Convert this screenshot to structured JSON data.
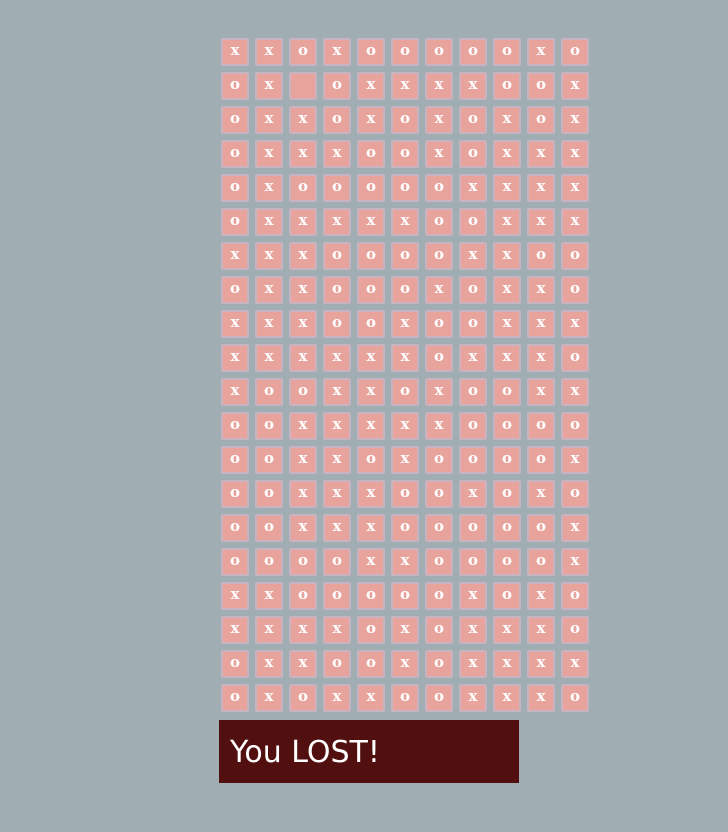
{
  "board": {
    "rows": [
      [
        "x",
        "x",
        "o",
        "x",
        "o",
        "o",
        "o",
        "o",
        "o",
        "x",
        "o"
      ],
      [
        "o",
        "x",
        "",
        "o",
        "x",
        "x",
        "x",
        "x",
        "o",
        "o",
        "x"
      ],
      [
        "o",
        "x",
        "x",
        "o",
        "x",
        "o",
        "x",
        "o",
        "x",
        "o",
        "x"
      ],
      [
        "o",
        "x",
        "x",
        "x",
        "o",
        "o",
        "x",
        "o",
        "x",
        "x",
        "x"
      ],
      [
        "o",
        "x",
        "o",
        "o",
        "o",
        "o",
        "o",
        "x",
        "x",
        "x",
        "x"
      ],
      [
        "o",
        "x",
        "x",
        "x",
        "x",
        "x",
        "o",
        "o",
        "x",
        "x",
        "x"
      ],
      [
        "x",
        "x",
        "x",
        "o",
        "o",
        "o",
        "o",
        "x",
        "x",
        "o",
        "o"
      ],
      [
        "o",
        "x",
        "x",
        "o",
        "o",
        "o",
        "x",
        "o",
        "x",
        "x",
        "o"
      ],
      [
        "x",
        "x",
        "x",
        "o",
        "o",
        "x",
        "o",
        "o",
        "x",
        "x",
        "x"
      ],
      [
        "x",
        "x",
        "x",
        "x",
        "x",
        "x",
        "o",
        "x",
        "x",
        "x",
        "o"
      ],
      [
        "x",
        "o",
        "o",
        "x",
        "x",
        "o",
        "x",
        "o",
        "o",
        "x",
        "x"
      ],
      [
        "o",
        "o",
        "x",
        "x",
        "x",
        "x",
        "x",
        "o",
        "o",
        "o",
        "o"
      ],
      [
        "o",
        "o",
        "x",
        "x",
        "o",
        "x",
        "o",
        "o",
        "o",
        "o",
        "x"
      ],
      [
        "o",
        "o",
        "x",
        "x",
        "x",
        "o",
        "o",
        "x",
        "o",
        "x",
        "o"
      ],
      [
        "o",
        "o",
        "x",
        "x",
        "x",
        "o",
        "o",
        "o",
        "o",
        "o",
        "x"
      ],
      [
        "o",
        "o",
        "o",
        "o",
        "x",
        "x",
        "o",
        "o",
        "o",
        "o",
        "x"
      ],
      [
        "x",
        "x",
        "o",
        "o",
        "o",
        "o",
        "o",
        "x",
        "o",
        "x",
        "o"
      ],
      [
        "x",
        "x",
        "x",
        "x",
        "o",
        "x",
        "o",
        "x",
        "x",
        "x",
        "o"
      ],
      [
        "o",
        "x",
        "x",
        "o",
        "o",
        "x",
        "o",
        "x",
        "x",
        "x",
        "x"
      ],
      [
        "o",
        "x",
        "o",
        "x",
        "x",
        "o",
        "o",
        "x",
        "x",
        "x",
        "o"
      ]
    ]
  },
  "status": {
    "message": "You LOST!"
  },
  "colors": {
    "background": "#a0adb3",
    "cell": "#e8a39d",
    "cell_border": "#c8b4c0",
    "status_bg": "#520f10",
    "text": "#ffffff"
  }
}
